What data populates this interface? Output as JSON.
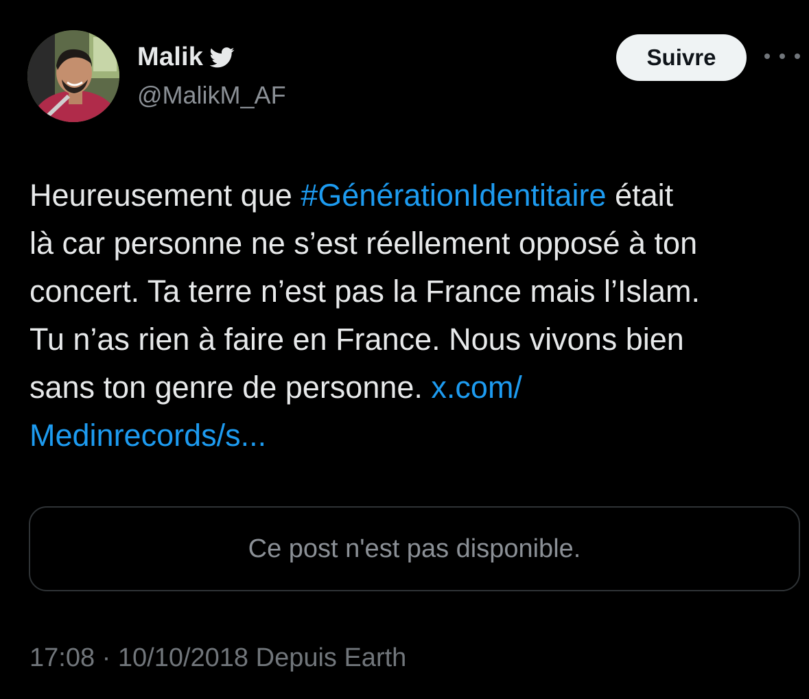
{
  "author": {
    "display_name": "Malik",
    "handle": "@MalikM_AF",
    "avatar_icon": "user-avatar-photo",
    "platform_icon": "twitter-bird-icon"
  },
  "actions": {
    "follow_label": "Suivre",
    "more_icon": "more-options-icon"
  },
  "tweet": {
    "line1_pre": "Heureusement que ",
    "line1_hashtag": "#GénérationIdentitaire",
    "line1_post": " était",
    "line2": "là car personne ne s’est réellement opposé à ton",
    "line3": "concert. Ta terre n’est pas la France mais l’Islam.",
    "line4": "Tu n’as rien à faire en France. Nous vivons bien",
    "line5_pre": "sans ton genre de personne. ",
    "line5_link": "x.com/",
    "line6_link": "Medinrecords/s..."
  },
  "quoted_post": {
    "unavailable_text": "Ce post n'est pas disponible."
  },
  "meta": {
    "time": "17:08",
    "separator": " · ",
    "date": "10/10/2018",
    "source": " Depuis Earth"
  },
  "colors": {
    "background": "#000000",
    "text": "#e7e9ea",
    "secondary": "#71767b",
    "link": "#1d9bf0",
    "button_bg": "#eff3f4"
  }
}
